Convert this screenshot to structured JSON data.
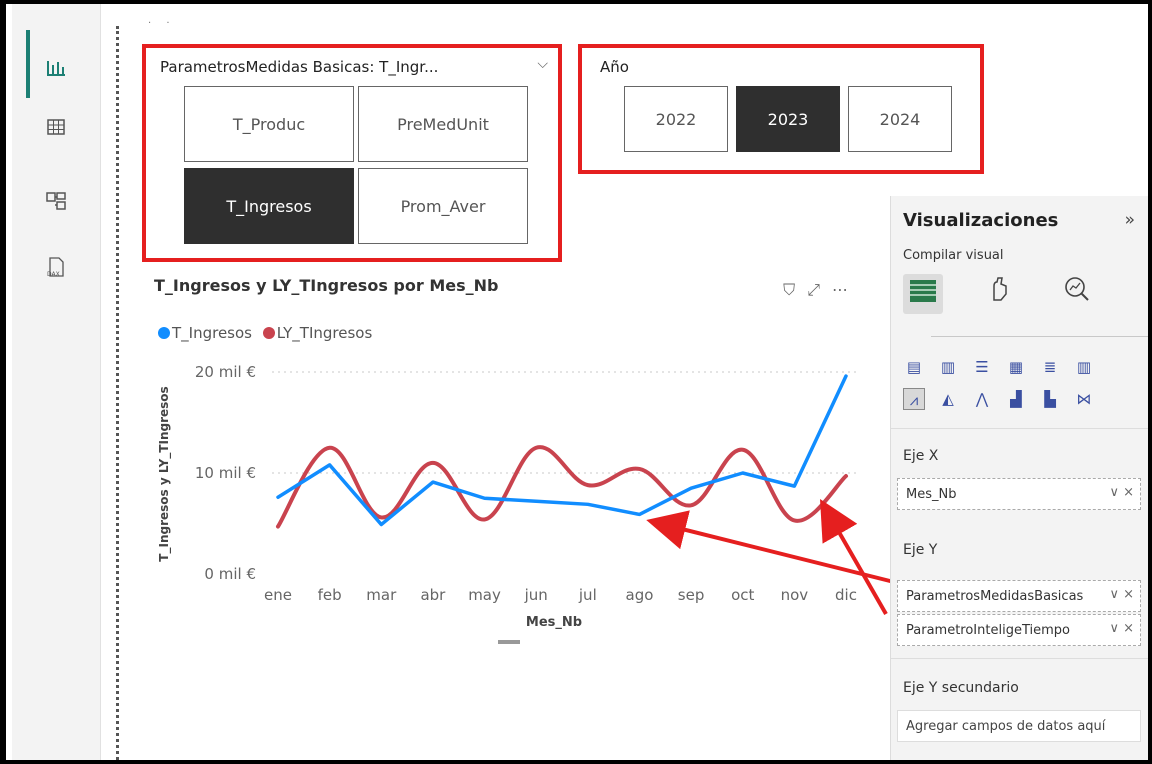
{
  "rail": {
    "icons": [
      "report-view-icon",
      "table-view-icon",
      "model-view-icon",
      "dax-query-icon"
    ]
  },
  "slicer1": {
    "title": "ParametrosMedidas Basicas: T_Ingr...",
    "options": [
      {
        "label": "T_Produc",
        "selected": false
      },
      {
        "label": "PreMedUnit",
        "selected": false
      },
      {
        "label": "T_Ingresos",
        "selected": true
      },
      {
        "label": "Prom_Aver",
        "selected": false
      }
    ]
  },
  "slicer2": {
    "title": "Año",
    "options": [
      {
        "label": "2022",
        "selected": false
      },
      {
        "label": "2023",
        "selected": true
      },
      {
        "label": "2024",
        "selected": false
      }
    ]
  },
  "visual": {
    "title": "T_Ingresos y LY_TIngresos por Mes_Nb",
    "tools": [
      "filter-icon",
      "focus-mode-icon",
      "more-options-icon"
    ]
  },
  "chart_data": {
    "type": "line",
    "title": "T_Ingresos y LY_TIngresos por Mes_Nb",
    "xlabel": "Mes_Nb",
    "ylabel": "T_Ingresos y LY_TIngresos",
    "categories": [
      "ene",
      "feb",
      "mar",
      "abr",
      "may",
      "jun",
      "jul",
      "ago",
      "sep",
      "oct",
      "nov",
      "dic"
    ],
    "yticks": [
      "0 mil €",
      "10 mil €",
      "20 mil €"
    ],
    "ylim": [
      0,
      20
    ],
    "grid": true,
    "legend_position": "top-left",
    "series": [
      {
        "name": "T_Ingresos",
        "color": "#118dff",
        "values": [
          7.6,
          10.8,
          4.9,
          9.1,
          7.5,
          7.2,
          6.9,
          5.9,
          8.5,
          10.0,
          8.7,
          19.6
        ]
      },
      {
        "name": "LY_TIngresos",
        "color": "#c9434e",
        "values": [
          4.7,
          12.5,
          5.6,
          11.0,
          5.4,
          12.5,
          8.8,
          10.4,
          6.8,
          12.3,
          5.3,
          9.7
        ]
      }
    ]
  },
  "pane": {
    "title": "Visualizaciones",
    "collapse_icon": "»",
    "subtitle": "Compilar visual",
    "tabs": [
      "build-visual-icon",
      "format-visual-icon",
      "analytics-icon"
    ],
    "wells": [
      {
        "label": "Eje X",
        "fields": [
          "Mes_Nb"
        ]
      },
      {
        "label": "Eje Y",
        "fields": [
          "ParametrosMedidasBasicas",
          "ParametroInteligeTiempo"
        ]
      },
      {
        "label": "Eje Y secundario",
        "placeholder": "Agregar campos de datos aquí"
      }
    ],
    "field_actions": "∨ ×"
  }
}
